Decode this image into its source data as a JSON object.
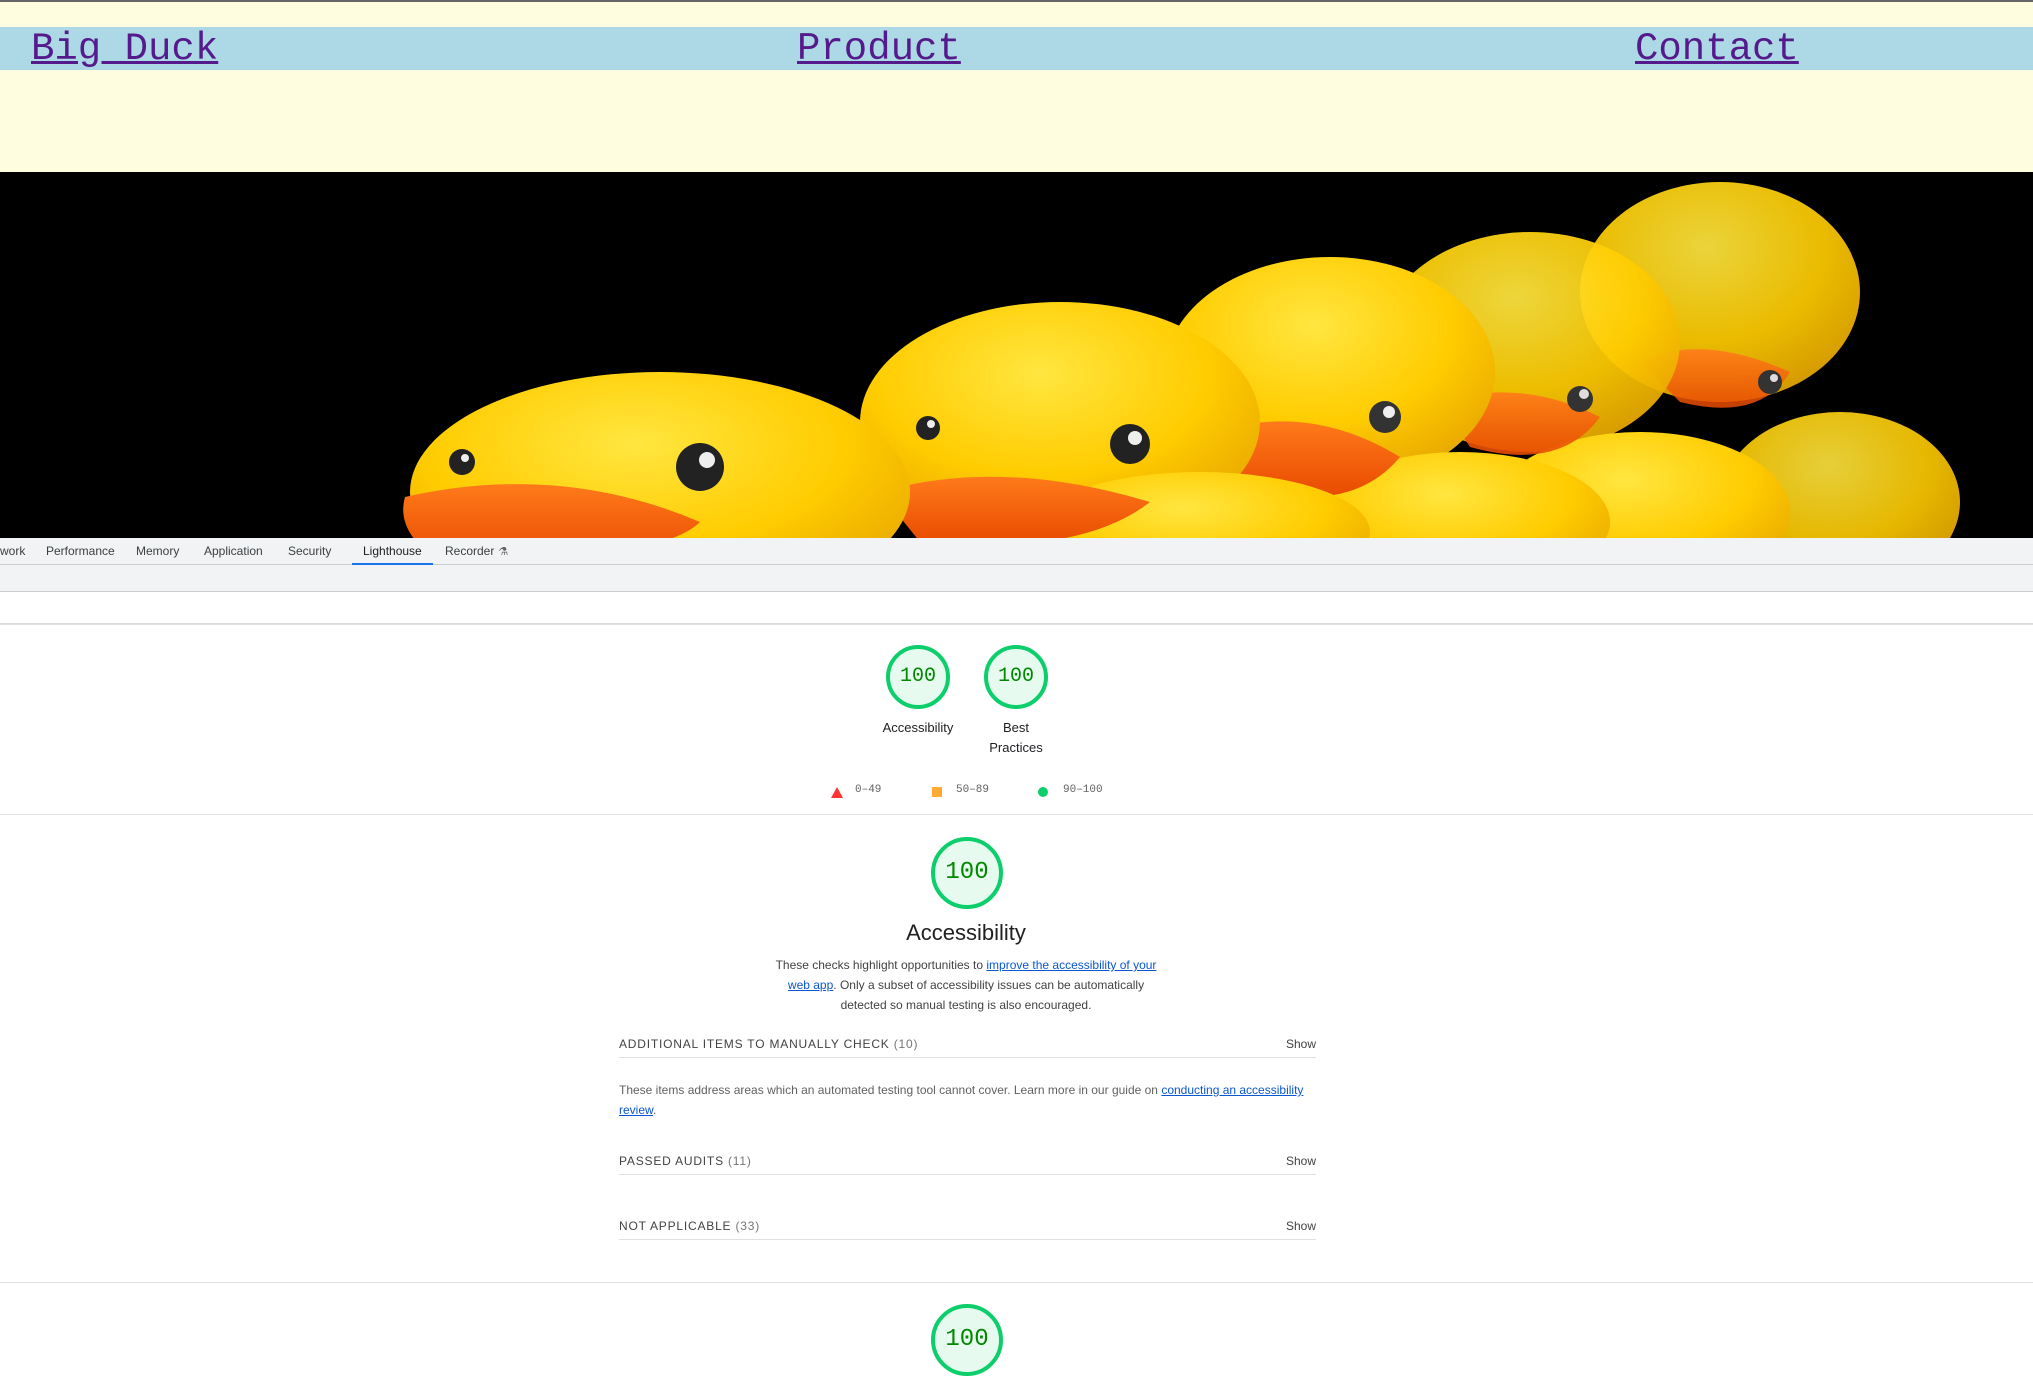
{
  "site": {
    "nav": [
      "Big Duck",
      "Product",
      "Contact"
    ],
    "hero_image": "rubber-ducks-photo"
  },
  "devtools": {
    "tabs": [
      "work",
      "Performance",
      "Memory",
      "Application",
      "Security",
      "Lighthouse",
      "Recorder"
    ],
    "active_tab": "Lighthouse",
    "recorder_icon": "flask-icon"
  },
  "summary": {
    "gauges": [
      {
        "score": "100",
        "label": "Accessibility"
      },
      {
        "score": "100",
        "label": "Best Practices",
        "label_line1": "Best",
        "label_line2": "Practices"
      }
    ],
    "legend": [
      {
        "range": "0–49",
        "shape": "triangle",
        "color": "#ff3333"
      },
      {
        "range": "50–89",
        "shape": "square",
        "color": "#ffaa33"
      },
      {
        "range": "90–100",
        "shape": "circle",
        "color": "#0cce6b"
      }
    ]
  },
  "category": {
    "score": "100",
    "title": "Accessibility",
    "desc_before": "These checks highlight opportunities to ",
    "desc_link": "improve the accessibility of your web app",
    "desc_after": ". Only a subset of accessibility issues can be automatically detected so manual testing is also encouraged.",
    "groups": [
      {
        "title": "Additional items to manually check",
        "count": "(10)",
        "action": "Show"
      },
      {
        "title": "Passed audits",
        "count": "(11)",
        "action": "Show"
      },
      {
        "title": "Not applicable",
        "count": "(33)",
        "action": "Show"
      }
    ],
    "manual_before": "These items address areas which an automated testing tool cannot cover. Learn more in our guide on ",
    "manual_link": "conducting an accessibility review",
    "manual_after": "."
  },
  "next_category": {
    "score": "100"
  },
  "colors": {
    "pass": "#0cce6b",
    "pass_text": "#008800",
    "nav_bg": "#add8e6",
    "page_bg": "#fffde0",
    "link": "#551a8b"
  }
}
